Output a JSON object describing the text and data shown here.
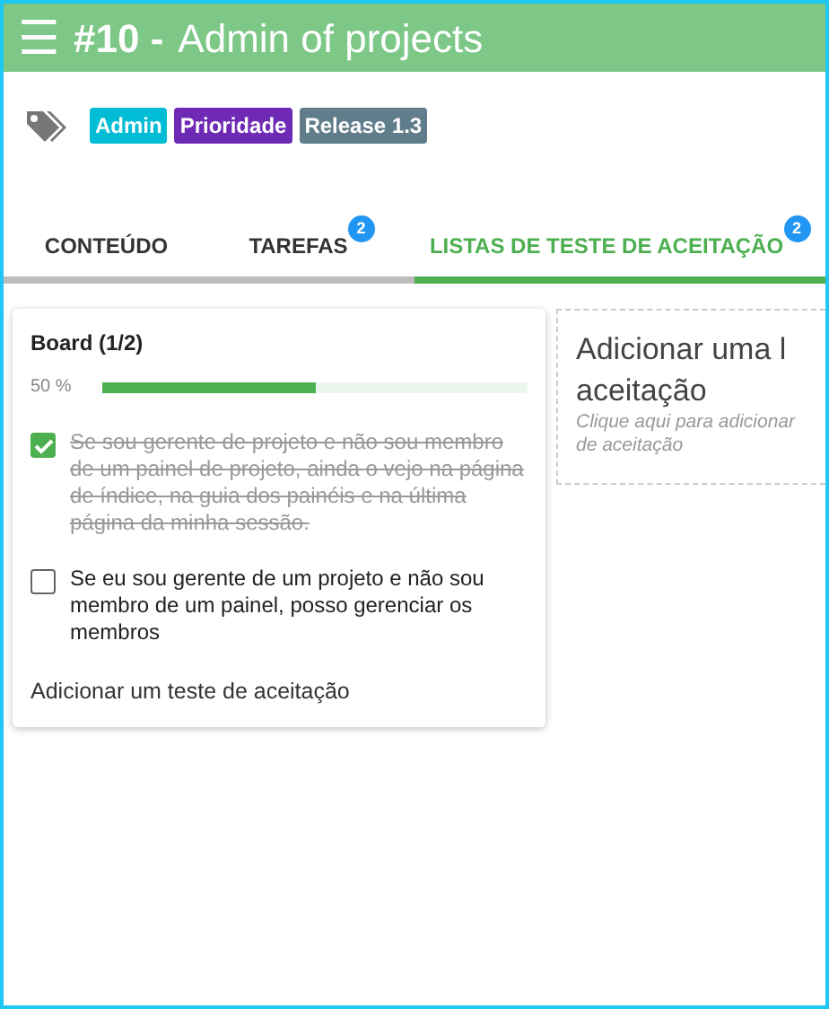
{
  "header": {
    "menu_icon": "☰",
    "number": "#10 -",
    "title": "Admin of projects"
  },
  "tags": [
    {
      "label": "Admin",
      "color": "#00bcd4"
    },
    {
      "label": "Prioridade",
      "color": "#6f2ab5"
    },
    {
      "label": "Release 1.3",
      "color": "#607d8b"
    }
  ],
  "tabs": [
    {
      "label": "CONTEÚDO",
      "selected": false
    },
    {
      "label": "TAREFAS",
      "badge": "2",
      "selected": false
    },
    {
      "label": "LISTAS DE TESTE DE ACEITAÇÃO",
      "badge": "2",
      "selected": true
    }
  ],
  "checklist": {
    "title": "Board (1/2)",
    "percent": "50 %",
    "level": 0.5,
    "items": [
      {
        "text": "Se sou gerente de projeto e não sou membro de um painel de projeto, ainda o vejo na página de índice, na guia dos painéis e na última página da minha sessão.",
        "checked": true
      },
      {
        "text": "Se eu sou gerente de um projeto e não sou membro de um painel, posso gerenciar os membros",
        "checked": false
      }
    ],
    "add_link": "Adicionar um teste de aceitação"
  },
  "new_list": {
    "title_lines": [
      "Adicionar uma l",
      "aceitação"
    ],
    "hint_lines": [
      "Clique aqui para adicionar",
      "de aceitação"
    ]
  }
}
